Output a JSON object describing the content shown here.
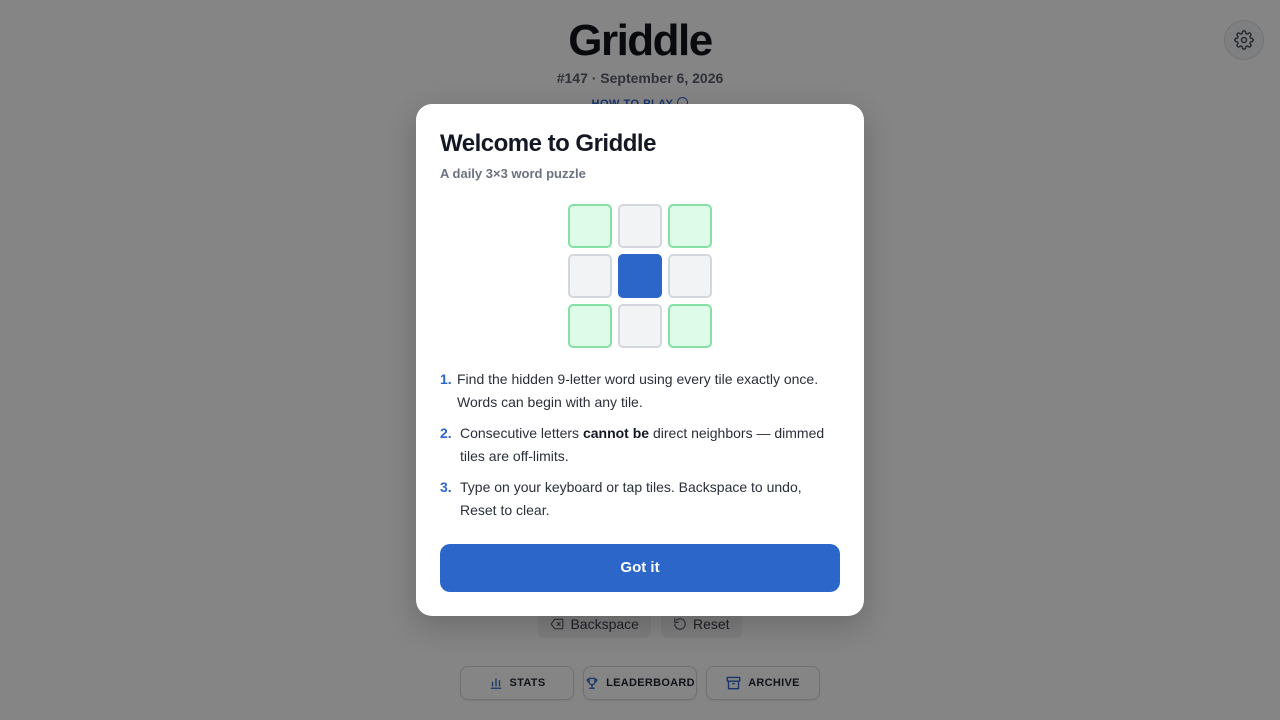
{
  "header": {
    "title": "Griddle",
    "subtitle": "#147 · September 6, 2026",
    "how_to_play": "HOW TO PLAY"
  },
  "actions": {
    "backspace": "Backspace",
    "reset": "Reset"
  },
  "nav": {
    "stats": "STATS",
    "leaderboard": "LEADERBOARD",
    "archive": "ARCHIVE"
  },
  "modal": {
    "title": "Welcome to Griddle",
    "subtitle": "A daily 3×3 word puzzle",
    "steps": [
      {
        "num": "1.",
        "text": "Find the hidden 9-letter word using every tile exactly once. Words can begin with any tile."
      },
      {
        "num": "2.",
        "text_before": "Consecutive letters ",
        "text_bold": "cannot be",
        "text_after": " direct neighbors — dimmed tiles are off-limits."
      },
      {
        "num": "3.",
        "text": "Type on your keyboard or tap tiles. Backspace to undo, Reset to clear."
      }
    ],
    "button": "Got it"
  },
  "colors": {
    "accent": "#2c66c8",
    "tile_available": "#ddfbe8",
    "tile_available_border": "#86e0a4",
    "tile_dimmed": "#f2f3f5",
    "overlay": "rgba(0,0,0,0.48)"
  },
  "icons": {
    "settings": "gear-icon",
    "how_to_play": "info-icon",
    "backspace": "backspace-icon",
    "reset": "undo-icon",
    "stats": "bar-chart-icon",
    "leaderboard": "trophy-icon",
    "archive": "archive-box-icon"
  }
}
